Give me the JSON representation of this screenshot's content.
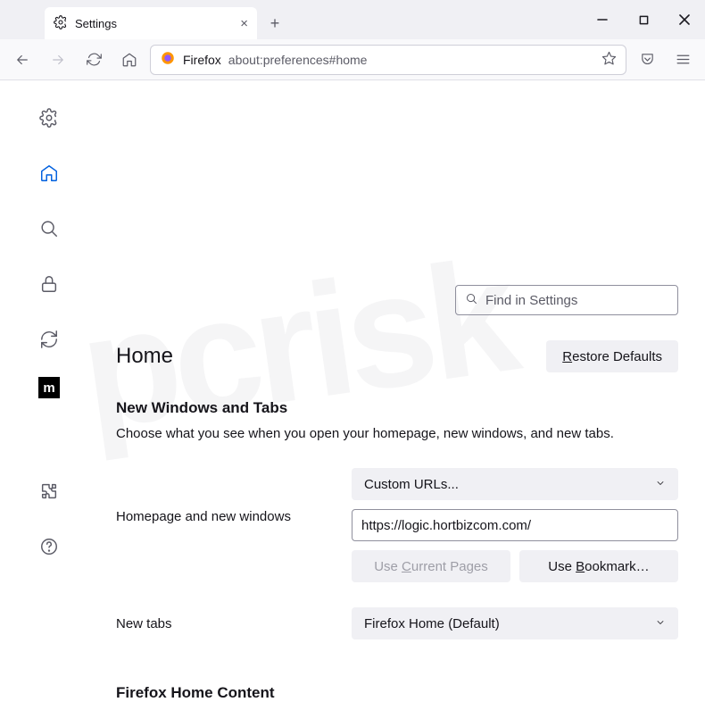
{
  "tab": {
    "title": "Settings"
  },
  "url": {
    "prefix": "Firefox",
    "path": "about:preferences#home"
  },
  "search": {
    "placeholder": "Find in Settings"
  },
  "page": {
    "title": "Home",
    "restore": "Restore Defaults",
    "section1_title": "New Windows and Tabs",
    "section1_desc": "Choose what you see when you open your homepage, new windows, and new tabs.",
    "homepage_label": "Homepage and new windows",
    "homepage_dropdown": "Custom URLs...",
    "homepage_value": "https://logic.hortbizcom.com/",
    "use_current": "Use Current Pages",
    "use_bookmark": "Use Bookmark…",
    "newtabs_label": "New tabs",
    "newtabs_dropdown": "Firefox Home (Default)",
    "section2_title": "Firefox Home Content"
  }
}
